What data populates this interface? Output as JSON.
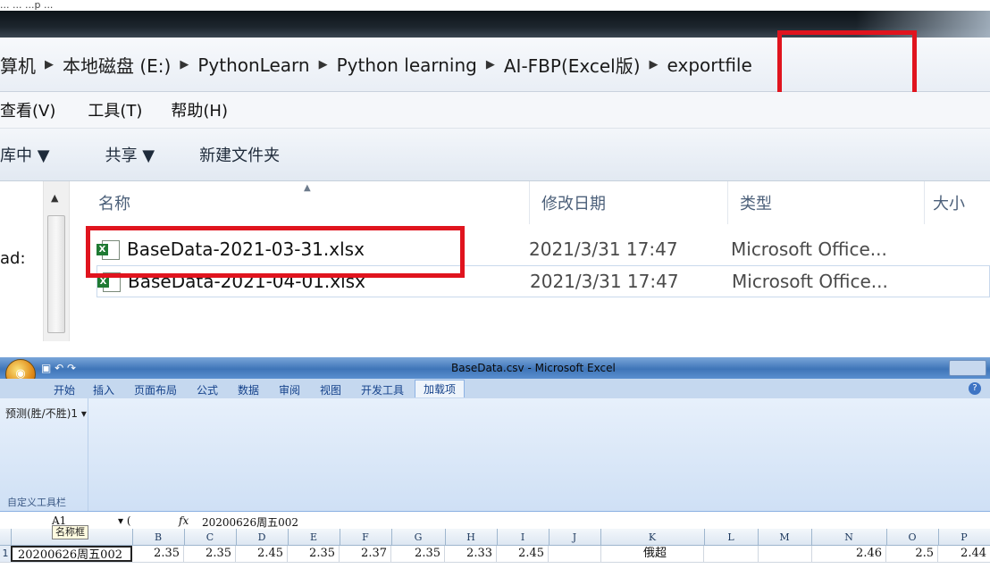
{
  "caption": "... ...  ...p ...",
  "explorer": {
    "breadcrumbs": [
      "算机",
      "本地磁盘 (E:)",
      "PythonLearn",
      "Python learning",
      "AI-FBP(Excel版)",
      "exportfile"
    ],
    "menu": [
      "查看(V)",
      "工具(T)",
      "帮助(H)"
    ],
    "toolbar": {
      "include_library": "库中 ▼",
      "share": "共享 ▼",
      "new_folder": "新建文件夹"
    },
    "columns": {
      "name": "名称",
      "modified": "修改日期",
      "type": "类型",
      "size": "大小"
    },
    "left_pane_item": "ad:",
    "files": [
      {
        "name": "BaseData-2021-03-31.xlsx",
        "modified": "2021/3/31 17:47",
        "type": "Microsoft Office..."
      },
      {
        "name": "BaseData-2021-04-01.xlsx",
        "modified": "2021/3/31 17:47",
        "type": "Microsoft Office..."
      }
    ],
    "highlight_color": "#e0141e"
  },
  "excel": {
    "title": "BaseData.csv - Microsoft Excel",
    "tabs": [
      "开始",
      "插入",
      "页面布局",
      "公式",
      "数据",
      "审阅",
      "视图",
      "开发工具",
      "加载项"
    ],
    "active_tab": "加载项",
    "ribbon_button": "预测(胜/不胜)1 ▾",
    "ribbon_group": "自定义工具栏",
    "cell_ref": "A1",
    "fx": "fx",
    "formula": "20200626周五002",
    "name_box_tooltip": "名称框",
    "columns": [
      "B",
      "C",
      "D",
      "E",
      "F",
      "G",
      "H",
      "I",
      "J",
      "K",
      "L",
      "M",
      "N",
      "O",
      "P"
    ],
    "row_number": "1",
    "row": {
      "A": "20200626周五002",
      "B": "2.35",
      "C": "2.35",
      "D": "2.45",
      "E": "2.35",
      "F": "2.37",
      "G": "2.35",
      "H": "2.33",
      "I": "2.45",
      "J": "",
      "K": "俄超",
      "L": "",
      "M": "",
      "N": "2.46",
      "O": "2.5",
      "P": "2.44"
    }
  }
}
